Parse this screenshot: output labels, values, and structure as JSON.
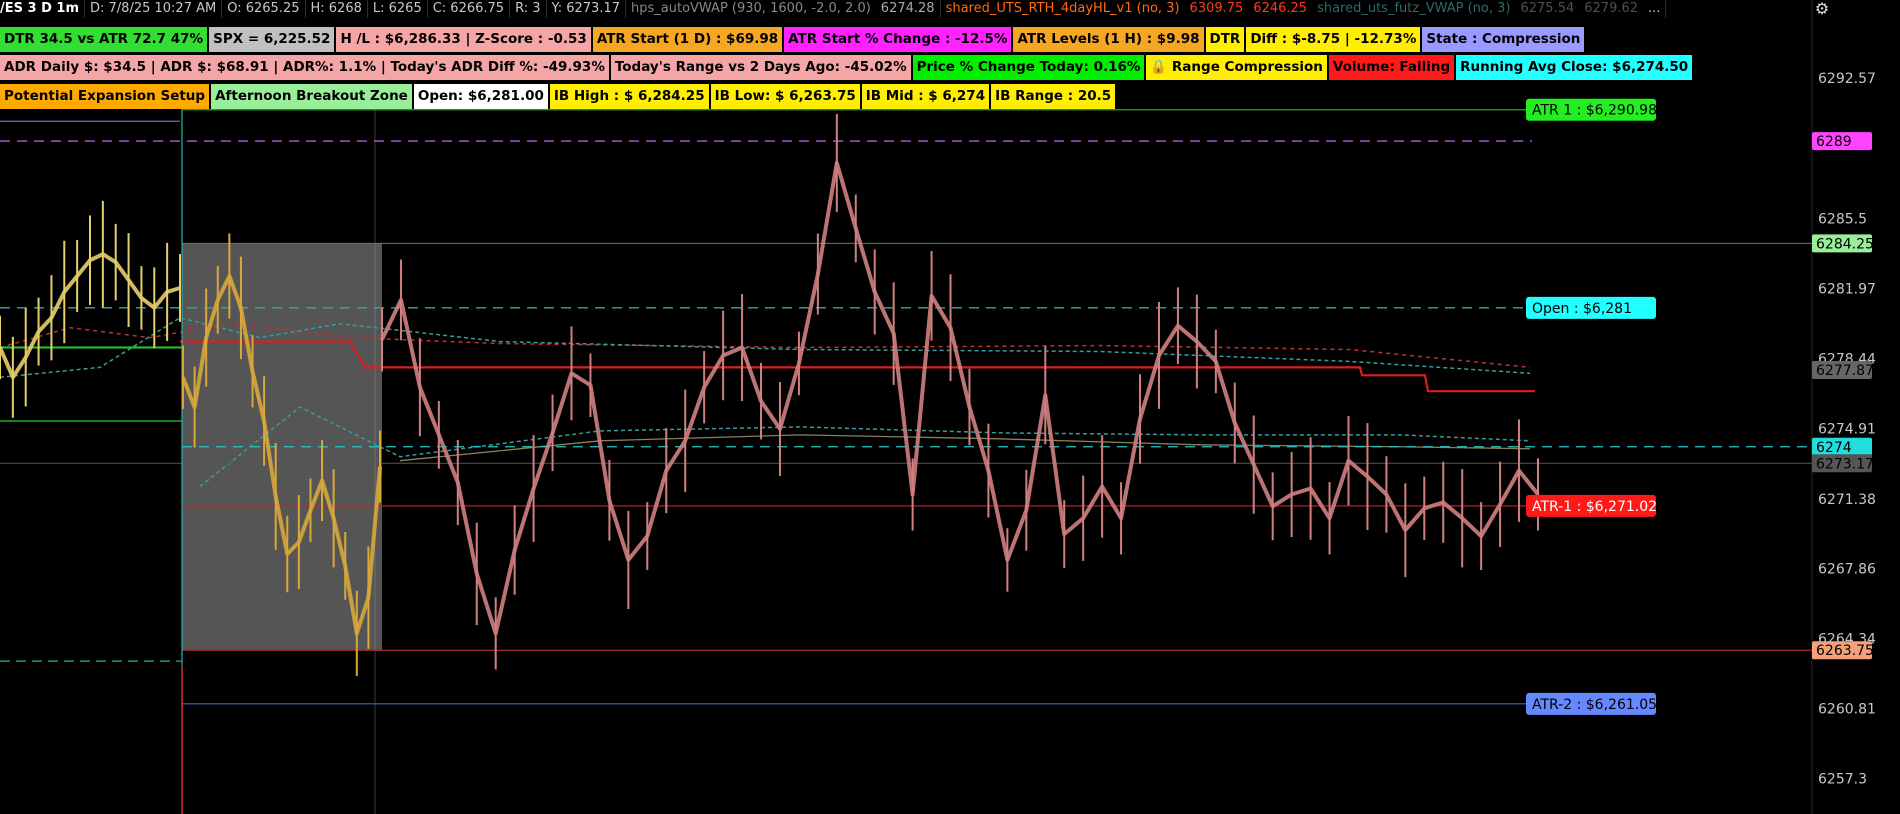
{
  "header": {
    "symbol": "/ES 3 D 1m",
    "date": "D: 7/8/25 10:27 AM",
    "open": "O: 6265.25",
    "high": "H: 6268",
    "low": "L: 6265",
    "close": "C: 6266.75",
    "range": "R: 3",
    "y": "Y: 6273.17",
    "vwap_name": "hps_autoVWAP (930, 1600, -2.0, 2.0)",
    "vwap_value": "6274.28",
    "study_name": "shared_UTS_RTH_4dayHL_v1 (no, 3)",
    "study_value1": "6309.75",
    "study_value2": "6246.25",
    "futz_name": "shared_uts_futz_VWAP (no, 3)",
    "futz_value1": "6275.54",
    "futz_value2": "6279.62",
    "more": "..."
  },
  "labels": [
    [
      {
        "text": "DTR 34.5 vs ATR 72.7  47%",
        "bg": "#33dd33"
      },
      {
        "text": "SPX = 6,225.52",
        "bg": "#c0c0c0"
      },
      {
        "text": "H /L : $6,286.33 | Z-Score : -0.53",
        "bg": "#f4a6a6"
      },
      {
        "text": "ATR Start (1 D) : $69.98",
        "bg": "#f5a623"
      },
      {
        "text": "ATR Start % Change : -12.5%",
        "bg": "#ff22ff"
      },
      {
        "text": "ATR Levels (1 H) : $9.98",
        "bg": "#f5a623"
      },
      {
        "text": "DTR",
        "bg": "#ffee00"
      },
      {
        "text": "Diff : $-8.75 | -12.73%",
        "bg": "#ffee00"
      },
      {
        "text": "State : Compression",
        "bg": "#9999ff"
      }
    ],
    [
      {
        "text": "ADR Daily $: $34.5 | ADR $: $68.91 | ADR%: 1.1% | Today's ADR Diff %: -49.93%",
        "bg": "#f4a6a6"
      },
      {
        "text": "Today's Range vs 2 Days Ago: -45.02%",
        "bg": "#f4a6a6"
      },
      {
        "text": "Price % Change Today: 0.16%",
        "bg": "#00ee00"
      },
      {
        "text": "🔒 Range Compression",
        "bg": "#ffee00"
      },
      {
        "text": "Volume: Falling",
        "bg": "#ff1a1a"
      },
      {
        "text": "Running Avg Close: $6,274.50",
        "bg": "#22ffff"
      }
    ],
    [
      {
        "text": "Potential Expansion Setup",
        "bg": "#ffaa00"
      },
      {
        "text": "Afternoon Breakout Zone",
        "bg": "#99ee99"
      },
      {
        "text": "Open: $6,281.00",
        "bg": "#ffffff"
      },
      {
        "text": "IB High : $ 6,284.25",
        "bg": "#ffee00"
      },
      {
        "text": "IB Low: $ 6,263.75",
        "bg": "#ffee00"
      },
      {
        "text": "IB Mid : $ 6,274",
        "bg": "#ffee00"
      },
      {
        "text": "IB Range : 20.5",
        "bg": "#ffee00"
      }
    ]
  ],
  "chart_data": {
    "type": "candlestick",
    "symbol": "/ES",
    "timeframe": "1m",
    "ylim": [
      6255.5,
      6295.5
    ],
    "y_ticks": [
      6292.57,
      6285.5,
      6281.97,
      6278.44,
      6274.91,
      6271.38,
      6267.86,
      6264.34,
      6260.81,
      6257.3
    ],
    "y_tick_labels": [
      "6292.57",
      "6285.5",
      "6281.97",
      "6278.44",
      "6274.91",
      "6271.38",
      "6267.86",
      "6264.34",
      "6260.81",
      "6257.3"
    ],
    "axis_badges": [
      {
        "text": "6289",
        "value": 6289.4,
        "bg": "#ff44ff"
      },
      {
        "text": "6284.25",
        "value": 6284.25,
        "bg": "#99ee99"
      },
      {
        "text": "6277.87",
        "value": 6277.87,
        "bg": "#666666"
      },
      {
        "text": "6274",
        "value": 6274.0,
        "bg": "#22dddd"
      },
      {
        "text": "6273.17",
        "value": 6273.17,
        "bg": "#555555"
      },
      {
        "text": "6263.75",
        "value": 6263.75,
        "bg": "#f4a07a"
      }
    ],
    "level_labels": [
      {
        "text": "ATR 1 : $6,290.98",
        "value": 6290.98,
        "bg": "#22ee22",
        "color": "#000000"
      },
      {
        "text": "Open : $6,281",
        "value": 6281.0,
        "bg": "#22ffff",
        "color": "#000000"
      },
      {
        "text": "ATR-1 : $6,271.02",
        "value": 6271.02,
        "bg": "#ff1a1a",
        "color": "#ffffff"
      },
      {
        "text": "ATR-2 : $6,261.05",
        "value": 6261.05,
        "bg": "#6688ff",
        "color": "#000000"
      }
    ],
    "series": [
      {
        "name": "pre-market",
        "color": "#e6cf6a",
        "values": [
          6279.0,
          6277.5,
          6278.5,
          6279.8,
          6280.5,
          6281.8,
          6282.6,
          6283.4,
          6283.7,
          6283.3,
          6282.4,
          6281.5,
          6281.0,
          6281.8,
          6282.0
        ]
      },
      {
        "name": "initial balance",
        "color": "#d8a83a",
        "values": [
          6277.5,
          6276.0,
          6279.5,
          6281.4,
          6282.6,
          6281.0,
          6277.8,
          6275.3,
          6271.5,
          6268.6,
          6269.2,
          6270.8,
          6272.3,
          6270.4,
          6268.0,
          6264.6,
          6266.4,
          6273.0
        ]
      },
      {
        "name": "session",
        "color": "#d08080",
        "values": [
          6279.4,
          6281.4,
          6277.0,
          6274.6,
          6272.2,
          6267.6,
          6264.6,
          6268.8,
          6271.9,
          6274.7,
          6277.7,
          6277.1,
          6271.3,
          6268.3,
          6269.5,
          6272.8,
          6274.3,
          6277.0,
          6278.6,
          6279.0,
          6276.3,
          6274.9,
          6278.2,
          6282.7,
          6288.3,
          6285.0,
          6281.8,
          6279.7,
          6271.6,
          6281.6,
          6280.0,
          6276.0,
          6272.8,
          6268.3,
          6270.8,
          6276.6,
          6269.6,
          6270.4,
          6272.0,
          6270.4,
          6275.4,
          6278.6,
          6280.1,
          6279.3,
          6278.3,
          6275.2,
          6273.1,
          6271.0,
          6271.6,
          6271.9,
          6270.4,
          6273.3,
          6272.5,
          6271.6,
          6269.8,
          6270.9,
          6271.2,
          6270.4,
          6269.5,
          6271.1,
          6272.8,
          6271.6
        ]
      }
    ],
    "reference_lines": [
      6290.98,
      6289.4,
      6284.25,
      6281.0,
      6274.0,
      6273.17,
      6271.02,
      6263.75,
      6261.05
    ]
  }
}
